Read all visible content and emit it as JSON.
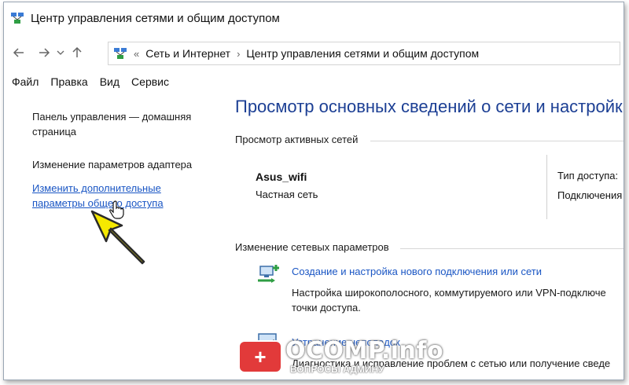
{
  "window": {
    "title": "Центр управления сетями и общим доступом"
  },
  "nav": {
    "back_icon": "arrow-left-icon",
    "forward_icon": "arrow-right-icon",
    "recent_icon": "chevron-down-icon",
    "up_icon": "arrow-up-icon"
  },
  "address": {
    "overflow": "«",
    "crumbs": [
      "Сеть и Интернет",
      "Центр управления сетями и общим доступом"
    ],
    "separator": "›"
  },
  "menu": {
    "items": [
      "Файл",
      "Правка",
      "Вид",
      "Сервис"
    ]
  },
  "left_pane": {
    "home_link": "Панель управления — домашняя страница",
    "adapter_link": "Изменение параметров адаптера",
    "sharing_link": "Изменить дополнительные параметры общего доступа"
  },
  "main": {
    "title": "Просмотр основных сведений о сети и настройка",
    "active_networks_header": "Просмотр активных сетей",
    "network": {
      "name": "Asus_wifi",
      "category": "Частная сеть",
      "access_type_label": "Тип доступа:",
      "connections_label": "Подключения"
    },
    "change_settings_header": "Изменение сетевых параметров",
    "tasks": [
      {
        "icon": "new-connection-icon",
        "link": "Создание и настройка нового подключения или сети",
        "desc_line1": "Настройка широкополосного, коммутируемого или VPN-подключе",
        "desc_line2": "точки доступа."
      },
      {
        "icon": "troubleshoot-icon",
        "link": "Устранение неполадок",
        "desc_line1": "Диагностика и исправление проблем с сетью или получение сведе"
      }
    ]
  },
  "watermark": {
    "brand": "OCOMP.info",
    "tagline": "ВОПРОСЫ АДМИНУ"
  },
  "colors": {
    "link_blue": "#1a56c4",
    "title_blue": "#1c3f94",
    "arrow_yellow": "#f5e800",
    "watermark_red": "#e23a3a"
  }
}
